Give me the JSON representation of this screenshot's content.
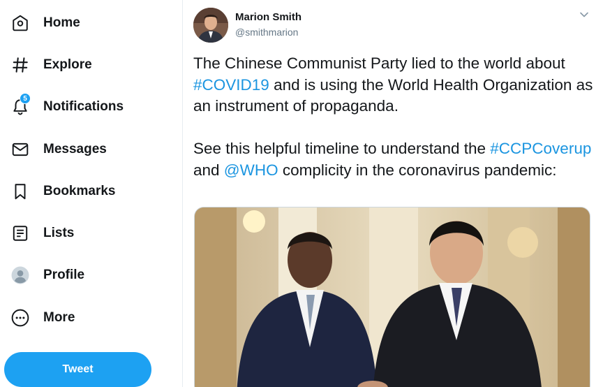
{
  "sidebar": {
    "items": [
      {
        "label": "Home",
        "icon": "home-icon"
      },
      {
        "label": "Explore",
        "icon": "hashtag-icon"
      },
      {
        "label": "Notifications",
        "icon": "bell-icon",
        "badge": "5"
      },
      {
        "label": "Messages",
        "icon": "envelope-icon"
      },
      {
        "label": "Bookmarks",
        "icon": "bookmark-icon"
      },
      {
        "label": "Lists",
        "icon": "list-icon"
      },
      {
        "label": "Profile",
        "icon": "profile-icon"
      },
      {
        "label": "More",
        "icon": "more-icon"
      }
    ],
    "tweet_button": "Tweet"
  },
  "tweet": {
    "display_name": "Marion Smith",
    "handle": "@smithmarion",
    "text_1a": "The Chinese Communist Party lied to the world about ",
    "hashtag_covid": "#COVID19",
    "text_1b": " and is using the World Health Organization as an instrument of propaganda.",
    "text_2a": "See this helpful timeline to understand the ",
    "hashtag_ccp": "#CCPCoverup",
    "text_2b": " and ",
    "mention_who": "@WHO",
    "text_2c": " complicity in the coronavirus pandemic:"
  },
  "colors": {
    "accent": "#1da1f2",
    "link": "#1b95e0",
    "text": "#14171a",
    "secondary": "#657786"
  }
}
